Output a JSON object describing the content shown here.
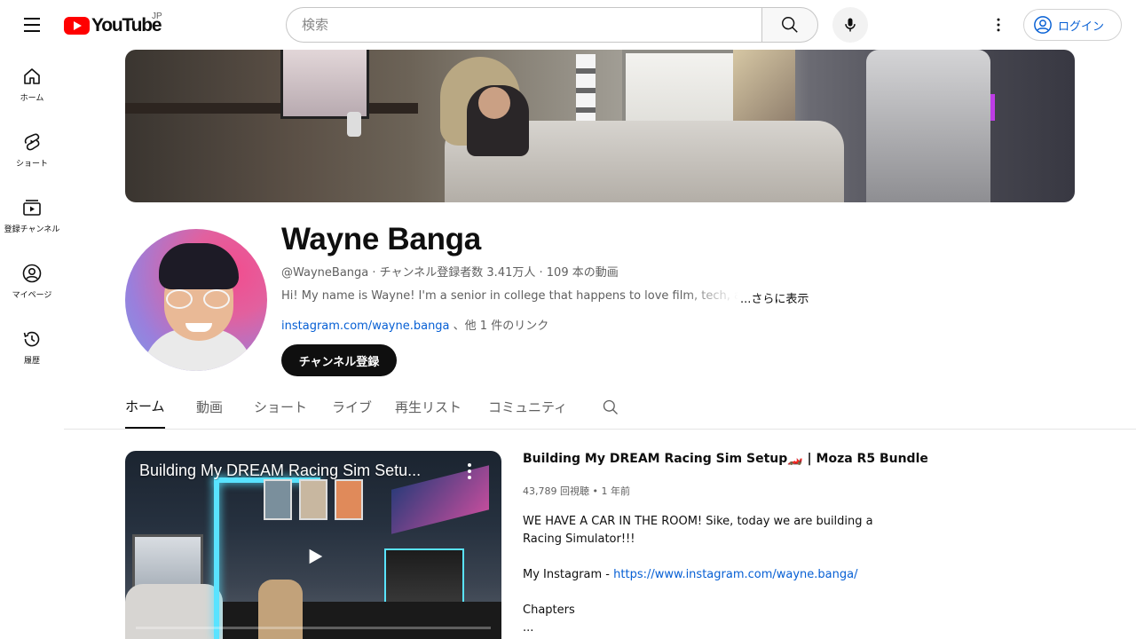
{
  "header": {
    "logo_text": "YouTube",
    "region": "JP",
    "search_placeholder": "検索",
    "login_label": "ログイン"
  },
  "sidenav": {
    "items": [
      {
        "label": "ホーム",
        "icon": "home-icon"
      },
      {
        "label": "ショート",
        "icon": "shorts-icon"
      },
      {
        "label": "登録チャンネル",
        "icon": "subscriptions-icon"
      },
      {
        "label": "マイページ",
        "icon": "you-icon"
      },
      {
        "label": "履歴",
        "icon": "history-icon"
      }
    ]
  },
  "channel": {
    "name": "Wayne Banga",
    "handle": "@WayneBanga",
    "subscribers": "チャンネル登録者数 3.41万人",
    "video_count": "109 本の動画",
    "description": "Hi! My name is Wayne! I'm a senior in college that happens to love film, tech, and room setups!",
    "more_label": "...さらに表示",
    "link_text": "instagram.com/wayne.banga",
    "link_suffix": "、他 1 件のリンク",
    "subscribe_label": "チャンネル登録"
  },
  "tabs": [
    {
      "label": "ホーム",
      "active": true
    },
    {
      "label": "動画",
      "active": false
    },
    {
      "label": "ショート",
      "active": false
    },
    {
      "label": "ライブ",
      "active": false
    },
    {
      "label": "再生リスト",
      "active": false
    },
    {
      "label": "コミュニティ",
      "active": false
    }
  ],
  "featured": {
    "thumb_title": "Building My DREAM Racing Sim Setu...",
    "title": "Building My DREAM Racing Sim Setup🏎️ | Moza R5 Bundle",
    "views": "43,789 回視聴",
    "age": "1 年前",
    "desc_line1": "WE HAVE A CAR IN THE ROOM! Sike, today we are building a Racing Simulator!!!",
    "instagram_label": "My Instagram - ",
    "instagram_url": "https://www.instagram.com/wayne.banga/",
    "chapters_label": "Chapters",
    "ellipsis": "..."
  }
}
